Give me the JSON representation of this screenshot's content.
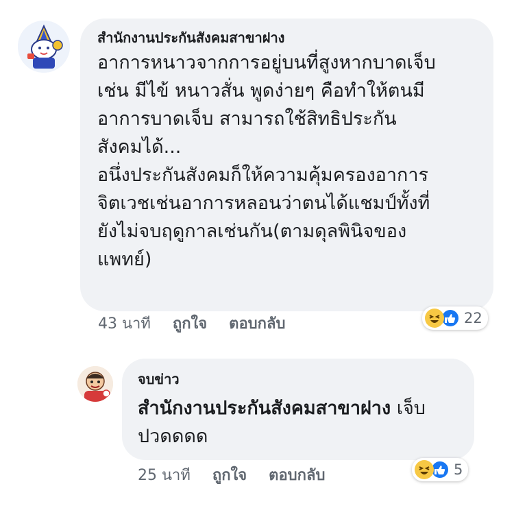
{
  "comments": [
    {
      "author": "สำนักงานประกันสังคมสาขาฝาง",
      "lines": [
        "อาการหนาวจากการอยู่บนที่สูงหากบาดเจ็บ",
        "เช่น มีไข้ หนาวสั่น พูดง่ายๆ คือทำให้ตนมี",
        "อาการบาดเจ็บ สามารถใช้สิทธิประกัน",
        "สังคมได้...",
        "อนึ่งประกันสังคมก็ให้ความคุ้มครองอาการ",
        "จิตเวชเช่นอาการหลอนว่าตนได้แชมป์ทั้งที่",
        "ยังไม่จบฤดูกาลเช่นกัน(ตามดุลพินิจของ",
        "แพทย์)"
      ],
      "time": "43 นาที",
      "like_label": "ถูกใจ",
      "reply_label": "ตอบกลับ",
      "reaction_count": "22",
      "reaction_icons": [
        "haha-icon",
        "like-icon"
      ]
    },
    {
      "author": "จบข่าว",
      "mention": "สำนักงานประกันสังคมสาขาฝาง",
      "text_after_mention": " เจ็บ",
      "line2": "ปวดดดด",
      "time": "25 นาที",
      "like_label": "ถูกใจ",
      "reply_label": "ตอบกลับ",
      "reaction_count": "5",
      "reaction_icons": [
        "haha-icon",
        "like-icon"
      ]
    }
  ],
  "colors": {
    "bubble": "#f0f2f5",
    "text": "#1c1e21",
    "meta": "#606770",
    "like_blue": "#1877f2",
    "haha_yellow": "#f7c844"
  }
}
